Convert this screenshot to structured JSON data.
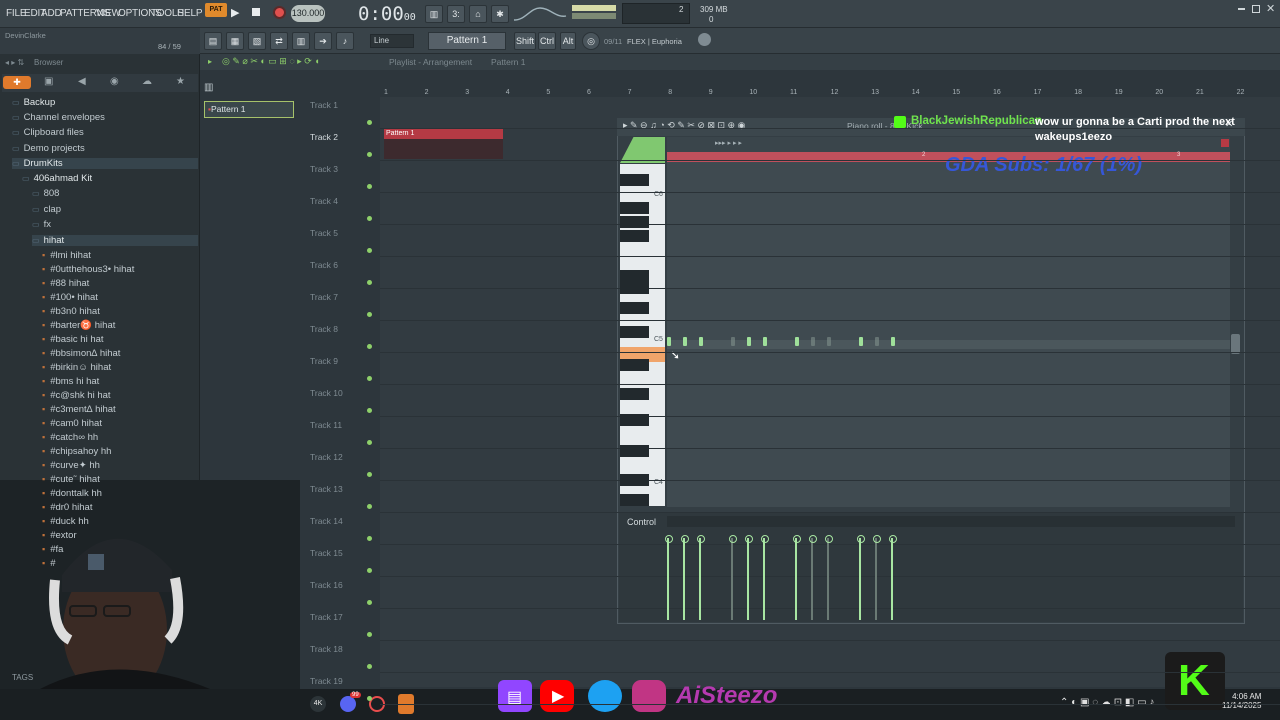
{
  "menu": [
    "FILE",
    "EDIT",
    "ADD",
    "PATTERNS",
    "VIEW",
    "OPTIONS",
    "TOOLS",
    "HELP"
  ],
  "transport": {
    "pat_label": "PAT",
    "tempo": "130.000",
    "time": "0:00",
    "time_small": "00",
    "cpu": "2",
    "memory": "309 MB",
    "mem2": "0"
  },
  "user": {
    "name": "DevinClarke",
    "counter": "84 / 59"
  },
  "toolbar2": {
    "snap": "Line",
    "pattern": "Pattern 1",
    "shift": "Shift",
    "ctrl": "Ctrl",
    "alt": "Alt",
    "plugin_counter": "09/11",
    "plugin": "FLEX | Euphoria"
  },
  "browser": {
    "title": "Browser",
    "items": [
      "Backup",
      "Channel envelopes",
      "Clipboard files",
      "Demo projects",
      "DrumKits",
      "406ahmad Kit",
      "808",
      "clap",
      "fx",
      "hihat"
    ],
    "files": [
      "#lmi hihat",
      "#0utthehous3• hihat",
      "#88 hihat",
      "#100• hihat",
      "#b3n0 hihat",
      "#barter♉ hihat",
      "#basic hi hat",
      "#bbsimon∆ hihat",
      "#birkin☺ hihat",
      "#bms hi hat",
      "#c@shk hi hat",
      "#c3ment∆ hihat",
      "#cam0 hihat",
      "#catch∞ hh",
      "#chipsahoy hh",
      "#curve✦ hh",
      "#cute˜ hihat",
      "#donttalk hh",
      "#dr0 hihat",
      "#duck hh",
      "#extor",
      "#fa",
      "#"
    ],
    "tags": "TAGS"
  },
  "playlist": {
    "title": "Playlist - Arrangement",
    "pattern": "Pattern 1",
    "pattern_item": "Pattern 1",
    "clip_label": "Pattern 1",
    "tracks": [
      "Track 1",
      "Track 2",
      "Track 3",
      "Track 4",
      "Track 5",
      "Track 6",
      "Track 7",
      "Track 8",
      "Track 9",
      "Track 10",
      "Track 11",
      "Track 12",
      "Track 13",
      "Track 14",
      "Track 15",
      "Track 16",
      "Track 17",
      "Track 18",
      "Track 19"
    ],
    "ruler": [
      "1",
      "2",
      "3",
      "4",
      "5",
      "6",
      "7",
      "8",
      "9",
      "10",
      "11",
      "12",
      "13",
      "14",
      "15",
      "16",
      "17",
      "18",
      "19",
      "20",
      "21",
      "22"
    ]
  },
  "pianoroll": {
    "title": "Piano roll - 808 Kick",
    "key_c6": "C6",
    "key_c5": "C5",
    "key_c4": "C4",
    "bar_2": "2",
    "bar_3": "3",
    "control": "Control",
    "notes": [
      0,
      1,
      2,
      4,
      5,
      6,
      8,
      9,
      10,
      12,
      13,
      14
    ],
    "note_dim": [
      4,
      9,
      10,
      13
    ]
  },
  "overlay": {
    "chat_user": "BlackJewishRepublican",
    "chat_msg": "wow ur gonna be a Carti prod the next wakeups1eezo",
    "subs": "GDA Subs: 1/67 (1%)",
    "brand": "AiSteezo"
  },
  "clock": {
    "time": "4:06 AM",
    "date": "11/14/2025"
  },
  "taskbar": {
    "tray1": "4K",
    "badge": "99"
  },
  "colors": {
    "accent_green": "#8ed06a",
    "clip_red": "#b53a44",
    "piano_bar": "#c0505c",
    "kick_green": "#53fc18"
  }
}
